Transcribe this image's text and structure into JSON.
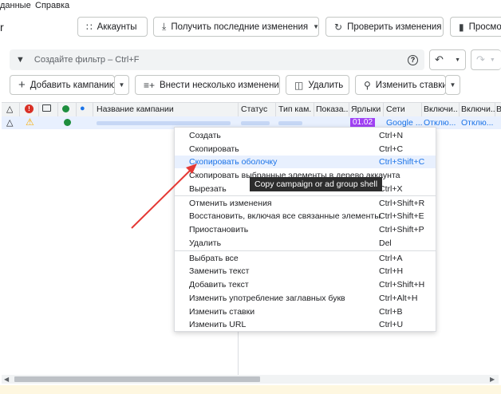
{
  "menubar": {
    "items": [
      "данные",
      "Справка"
    ]
  },
  "app": {
    "title_fragment": "r"
  },
  "toolbar": {
    "accounts": "Аккаунты",
    "get_changes": "Получить последние изменения",
    "check_changes": "Проверить изменения",
    "view": "Просмо"
  },
  "filter": {
    "placeholder": "Создайте фильтр – Ctrl+F"
  },
  "actions": {
    "add_campaign": "Добавить кампанию",
    "add_multiple": "Внести несколько изменений",
    "delete": "Удалить",
    "change_bids": "Изменить ставки"
  },
  "grid": {
    "columns": [
      "Название кампании",
      "Статус",
      "Тип кам...",
      "Показа...",
      "Ярлыки",
      "Сети",
      "Включи...",
      "Включи...",
      "В"
    ],
    "row": {
      "label_badge": "01.02",
      "networks": "Google ...",
      "col1": "Отклю...",
      "col2": "Отклю..."
    }
  },
  "context_menu": {
    "groups": [
      [
        {
          "label": "Создать",
          "shortcut": "Ctrl+N"
        },
        {
          "label": "Скопировать",
          "shortcut": "Ctrl+C"
        },
        {
          "label": "Скопировать оболочку",
          "shortcut": "Ctrl+Shift+C",
          "highlighted": true
        },
        {
          "label": "Скопировать выбранные элементы в дерево аккаунта",
          "shortcut": ""
        },
        {
          "label": "Вырезать",
          "shortcut": "Ctrl+X"
        }
      ],
      [
        {
          "label": "Отменить изменения",
          "shortcut": "Ctrl+Shift+R"
        },
        {
          "label": "Восстановить, включая все связанные элементы",
          "shortcut": "Ctrl+Shift+E"
        },
        {
          "label": "Приостановить",
          "shortcut": "Ctrl+Shift+P"
        },
        {
          "label": "Удалить",
          "shortcut": "Del"
        }
      ],
      [
        {
          "label": "Выбрать все",
          "shortcut": "Ctrl+A"
        },
        {
          "label": "Заменить текст",
          "shortcut": "Ctrl+H"
        },
        {
          "label": "Добавить текст",
          "shortcut": "Ctrl+Shift+H"
        },
        {
          "label": "Изменить употребление заглавных букв",
          "shortcut": "Ctrl+Alt+H"
        },
        {
          "label": "Изменить ставки",
          "shortcut": "Ctrl+B"
        },
        {
          "label": "Изменить URL",
          "shortcut": "Ctrl+U"
        }
      ]
    ]
  },
  "tooltip": {
    "text": "Copy campaign or ad group shell"
  },
  "colors": {
    "accent": "#1a73e8",
    "badge": "#a142f4",
    "status_green": "#1e8e3e",
    "warning": "#f9ab00",
    "error": "#d93025",
    "arrow": "#e53935"
  }
}
